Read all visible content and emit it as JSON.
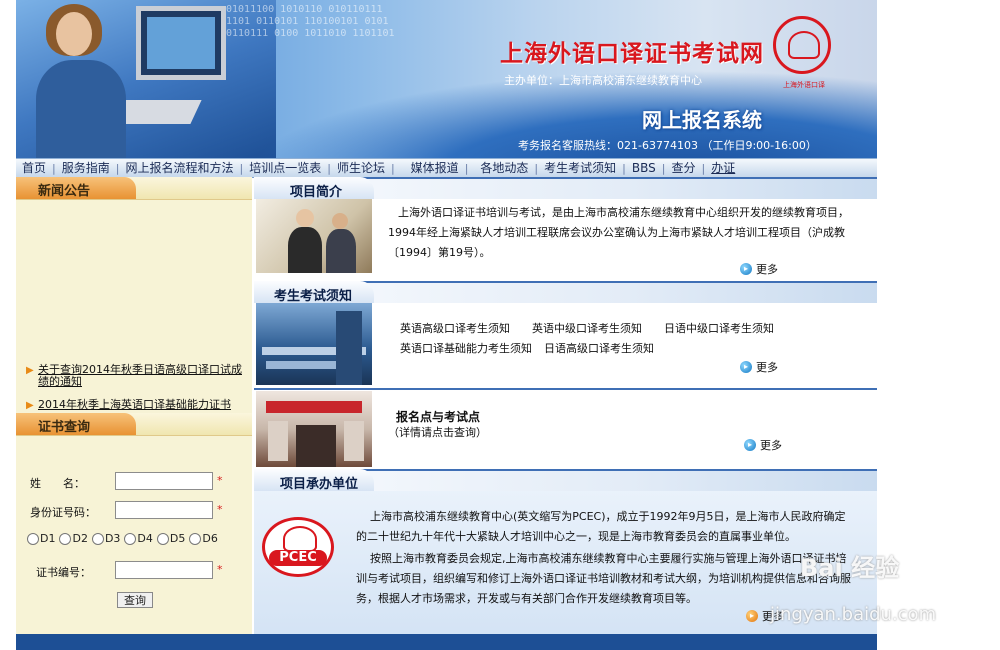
{
  "banner": {
    "site_title": "上海外语口译证书考试网",
    "sponsor": "主办单位：上海市高校浦东继续教育中心",
    "system_name": "网上报名系统",
    "hotline": "考务报名客服热线：021-63774103 （工作日9:00-16:00）",
    "logo_caption": "上海外语口译"
  },
  "nav": {
    "items": [
      "首页",
      "服务指南",
      "网上报名流程和方法",
      "培训点一览表",
      "师生论坛",
      "媒体报道",
      "各地动态",
      "考生考试须知",
      "BBS",
      "查分",
      "办证"
    ]
  },
  "left": {
    "news_title": "新闻公告",
    "news_items": [
      "关于查询2014年秋季日语高级口译口试成绩的通知",
      "2014年秋季上海英语口译基础能力证书"
    ],
    "cert_title": "证书查询",
    "form": {
      "name_label": "姓　　名：",
      "id_label": "身份证号码：",
      "cert_no_label": "证书编号：",
      "required_mark": "*",
      "radio_options": [
        "D1",
        "D2",
        "D3",
        "D4",
        "D5",
        "D6"
      ],
      "query_button": "查询"
    }
  },
  "right": {
    "sections": {
      "intro_title": "项目简介",
      "notice_title": "考生考试须知",
      "org_title": "项目承办单位"
    },
    "intro_text": "上海外语口译证书培训与考试，是由上海市高校浦东继续教育中心组织开发的继续教育项目，1994年经上海紧缺人才培训工程联席会议办公室确认为上海市紧缺人才培训工程项目（沪成教〔1994〕第19号）。",
    "more_label": "更多",
    "notice_links_row1": [
      "英语高级口译考生须知",
      "英语中级口译考生须知",
      "日语中级口译考生须知"
    ],
    "notice_links_row2": [
      "英语口译基础能力考生须知",
      "日语高级口译考生须知"
    ],
    "registration_title": "报名点与考试点",
    "registration_sub": "（详情请点击查询）",
    "org_para1": "上海市高校浦东继续教育中心(英文缩写为PCEC)，成立于1992年9月5日，是上海市人民政府确定的二十世纪九十年代十大紧缺人才培训中心之一，现是上海市教育委员会的直属事业单位。",
    "org_para2": "按照上海市教育委员会规定,上海市高校浦东继续教育中心主要履行实施与管理上海外语口译证书培训与考试项目，组织编写和修订上海外语口译证书培训教材和考试大纲，为培训机构提供信息和咨询服务，根据人才市场需求，开发或与有关部门合作开发继续教育项目等。",
    "org_logo_text": "PCEC"
  },
  "watermark": {
    "brand": "Bai 经验",
    "url": "jingyan.baidu.com"
  },
  "colors": {
    "title_red": "#d9171e",
    "nav_bg": "#c6d8ec",
    "left_bg": "#f7f3d6",
    "accent_blue": "#3f6fb5"
  }
}
